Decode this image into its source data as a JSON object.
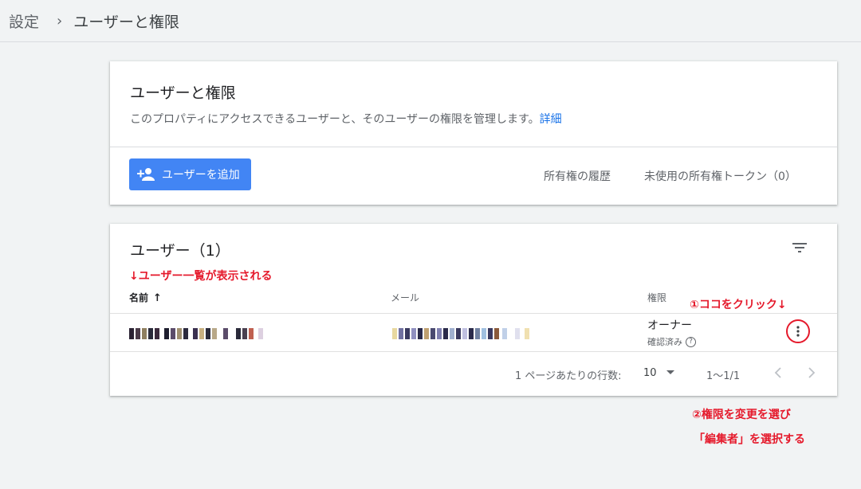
{
  "breadcrumb": {
    "parent": "設定",
    "current": "ユーザーと権限"
  },
  "access_card": {
    "title": "ユーザーと権限",
    "description": "このプロパティにアクセスできるユーザーと、そのユーザーの権限を管理します。",
    "details_link": "詳細",
    "add_user_button": "ユーザーを追加",
    "ownership_history": "所有権の履歴",
    "unused_tokens": "未使用の所有権トークン（0）"
  },
  "users_card": {
    "title": "ユーザー（1）",
    "columns": {
      "name": "名前",
      "email": "メール",
      "permission": "権限"
    },
    "rows": [
      {
        "permission_role": "オーナー",
        "permission_status": "確認済み"
      }
    ],
    "pagination": {
      "rows_per_page_label": "1 ページあたりの行数:",
      "rows_per_page": "10",
      "range": "1〜1/1"
    }
  },
  "annotations": {
    "list_note": "↓ユーザー一覧が表示される",
    "click_note": "①ココをクリック↓",
    "step2_line1": "②権限を変更を選び",
    "step2_line2": "「編集者」を選択する"
  },
  "colors": {
    "accent": "#4285f4",
    "link": "#1a73e8",
    "annotation": "#e5192b"
  }
}
